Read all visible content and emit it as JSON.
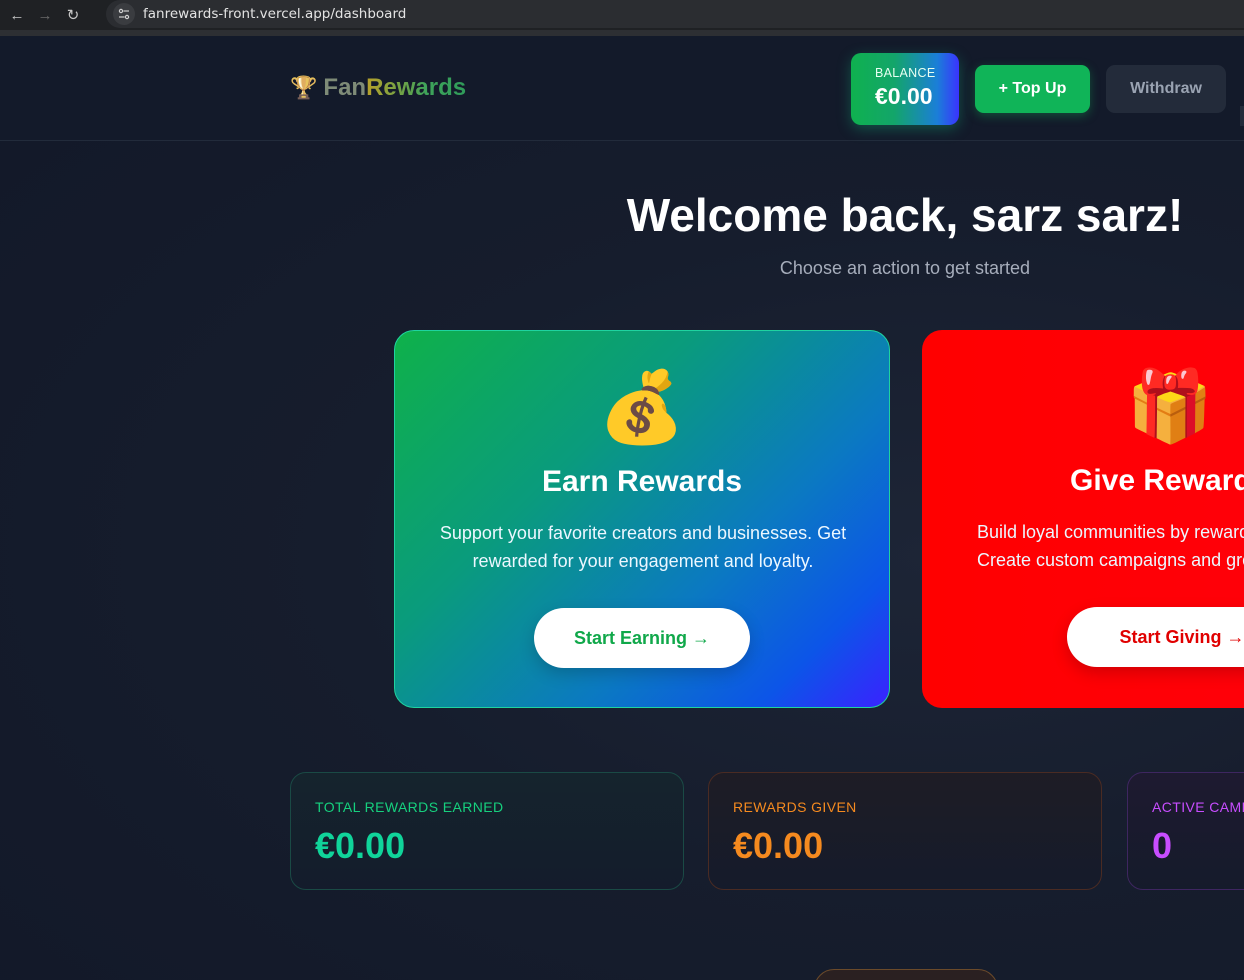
{
  "browser": {
    "url": "fanrewards-front.vercel.app/dashboard",
    "back_icon": "←",
    "forward_icon": "→",
    "reload_icon": "↻"
  },
  "header": {
    "logo_icon": "🏆",
    "logo_part1": "Fan",
    "logo_part2": "Rewards",
    "balance_label": "BALANCE",
    "balance_amount": "€0.00",
    "topup_label": "+ Top Up",
    "withdraw_label": "Withdraw"
  },
  "hero": {
    "title": "Welcome back, sarz sarz!",
    "subtitle": "Choose an action to get started"
  },
  "cards": {
    "earn": {
      "icon": "💰",
      "title": "Earn Rewards",
      "description": "Support your favorite creators and businesses. Get rewarded for your engagement and loyalty.",
      "button": "Start Earning →"
    },
    "give": {
      "icon": "🎁",
      "title": "Give Rewards",
      "description_line1": "Build loyal communities by rewarding",
      "description_line2": "Create custom campaigns and grow",
      "button": "Start Giving →"
    }
  },
  "stats": {
    "earned": {
      "label": "TOTAL REWARDS EARNED",
      "value": "€0.00"
    },
    "given": {
      "label": "REWARDS GIVEN",
      "value": "€0.00"
    },
    "active": {
      "label": "ACTIVE CAMPAIGNS",
      "value": "0"
    }
  },
  "colors": {
    "earned_accent": "#10d49a",
    "given_accent": "#f58a1f",
    "active_accent": "#c84dff",
    "topup_green": "#10b458",
    "give_red": "#ff0000"
  }
}
